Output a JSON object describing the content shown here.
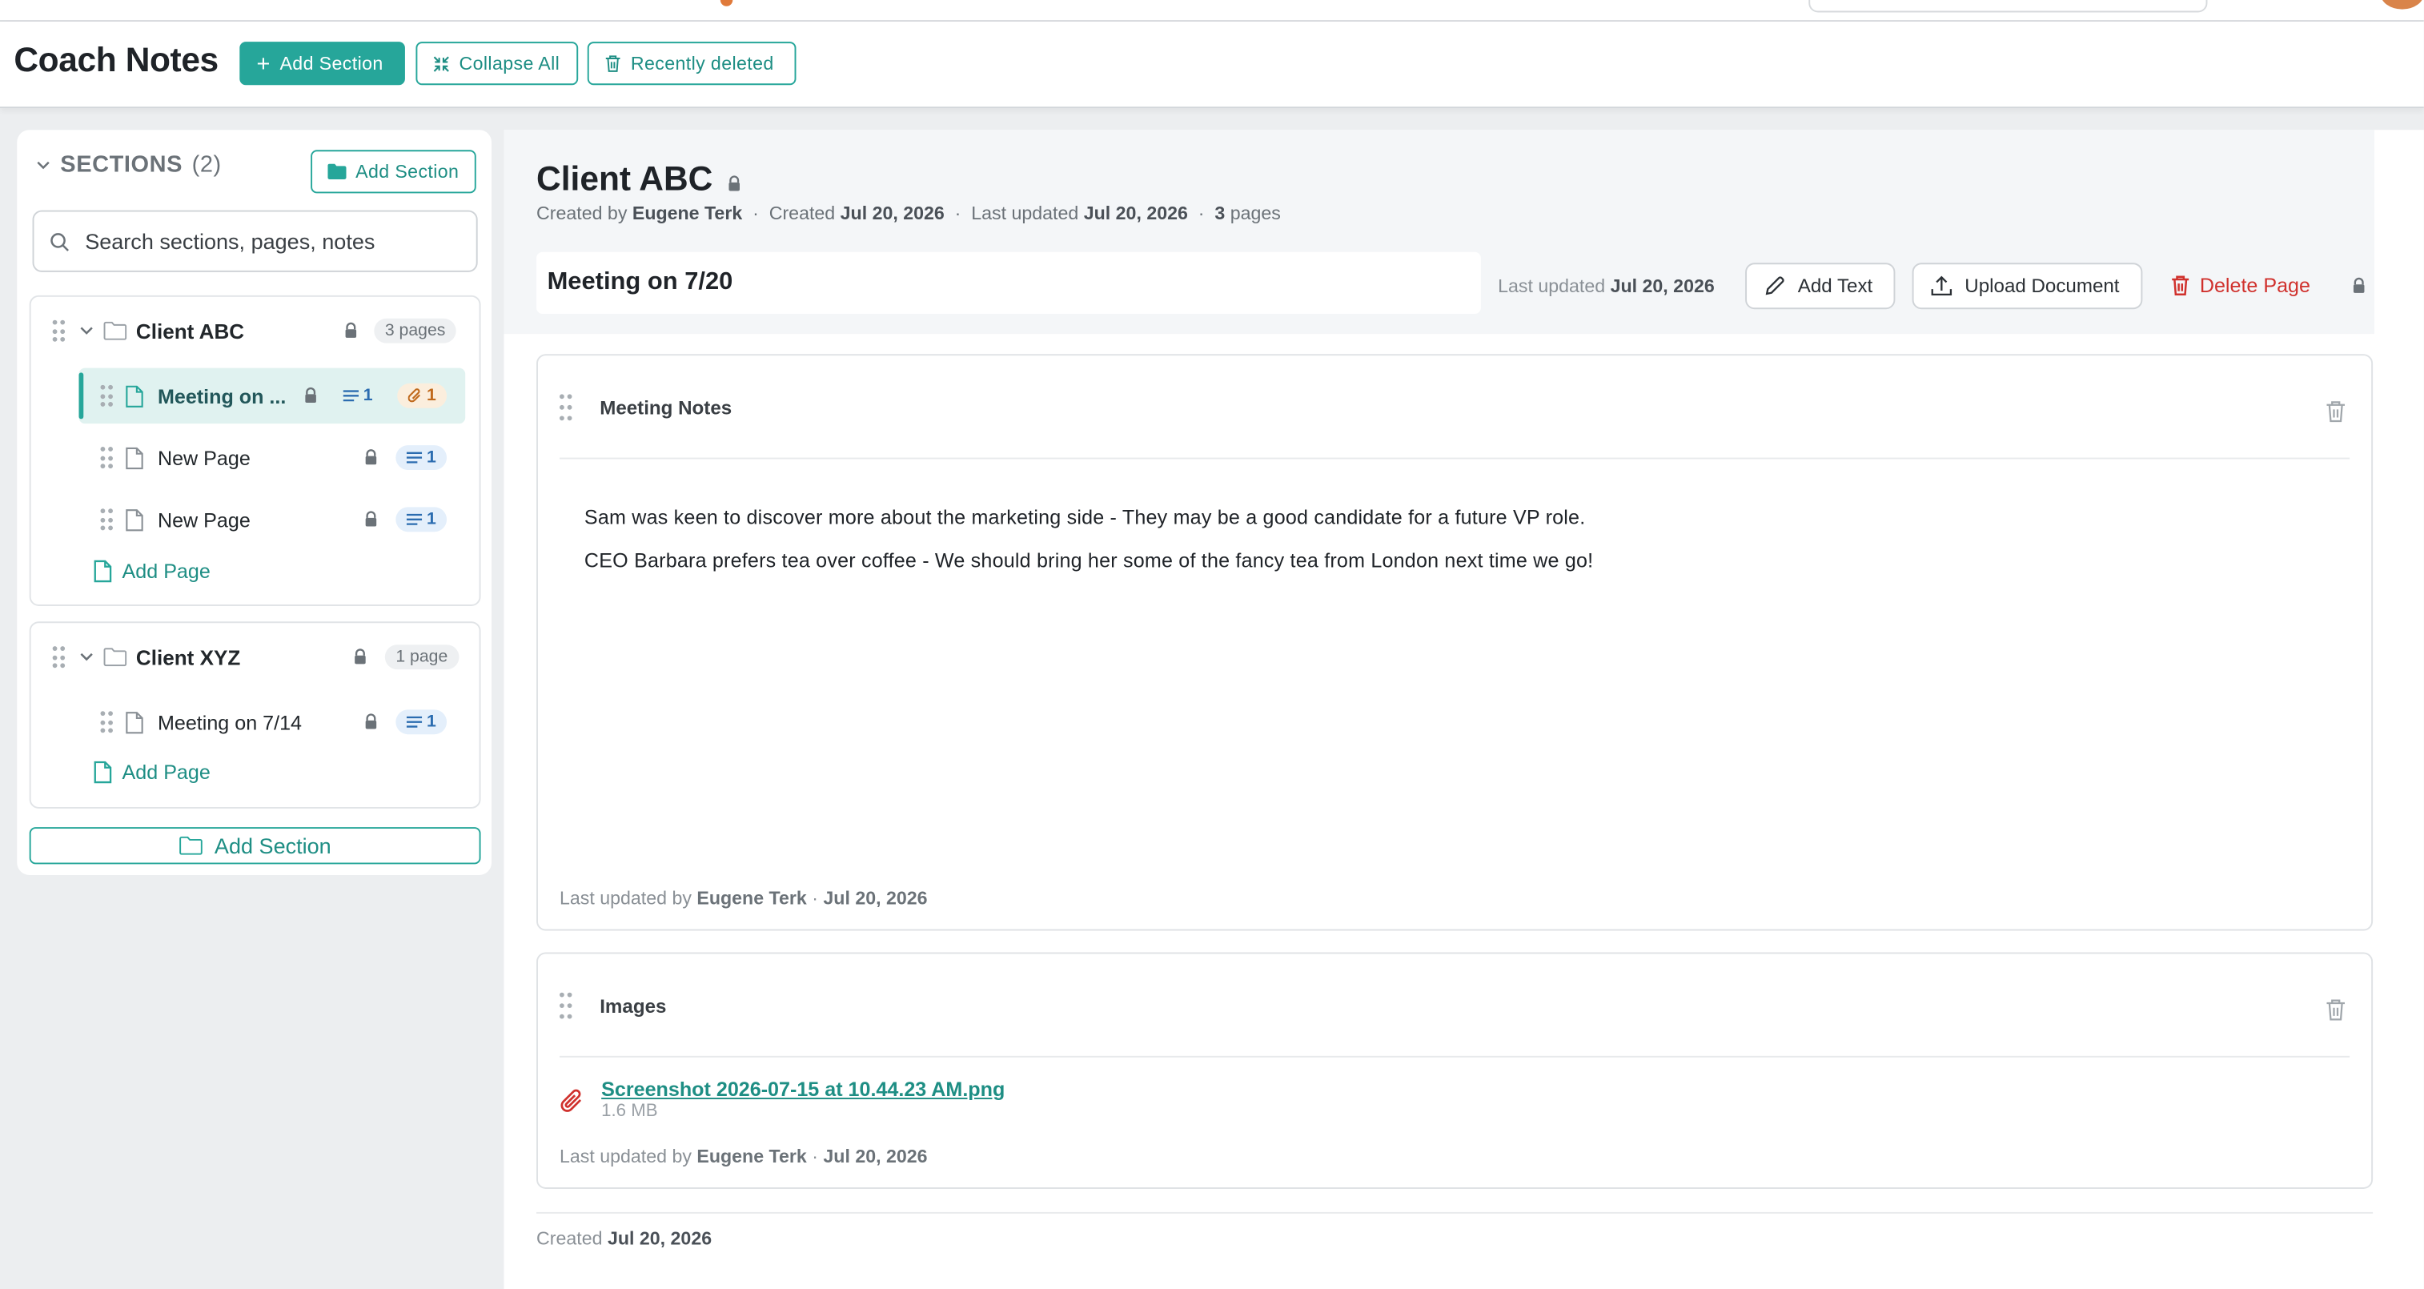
{
  "app": {
    "title": "Coach Notes",
    "add_section_label": "Add Section",
    "collapse_all_label": "Collapse All",
    "recently_deleted_label": "Recently deleted",
    "accent_color": "#26a69a"
  },
  "sidebar": {
    "heading": "SECTIONS",
    "count": "(2)",
    "add_section_label": "Add Section",
    "search_placeholder": "Search sections, pages, notes",
    "sections": [
      {
        "name": "Client ABC",
        "pages_badge": "3 pages",
        "pages": [
          {
            "name": "Meeting on ...",
            "notes": "1",
            "attachments": "1",
            "active": true
          },
          {
            "name": "New Page",
            "notes": "1"
          },
          {
            "name": "New Page",
            "notes": "1"
          }
        ],
        "add_page_label": "Add Page"
      },
      {
        "name": "Client XYZ",
        "pages_badge": "1 page",
        "pages": [
          {
            "name": "Meeting on 7/14",
            "notes": "1"
          }
        ],
        "add_page_label": "Add Page"
      }
    ],
    "bottom_add_section_label": "Add Section"
  },
  "main": {
    "section_title": "Client ABC",
    "meta": {
      "created_by_label": "Created by",
      "created_by": "Eugene Terk",
      "created_label": "Created",
      "created": "Jul 20, 2026",
      "last_updated_label": "Last updated",
      "last_updated": "Jul 20, 2026",
      "pages_count": "3",
      "pages_label": "pages"
    },
    "page_name": "Meeting on 7/20",
    "page_last_updated_label": "Last updated",
    "page_last_updated": "Jul 20, 2026",
    "add_text_label": "Add Text",
    "upload_document_label": "Upload Document",
    "delete_page_label": "Delete Page",
    "notes_card": {
      "title": "Meeting Notes",
      "lines": [
        "Sam was keen to discover more about the marketing side - They may be a good candidate for a future VP role.",
        "CEO Barbara prefers tea over coffee - We should bring her some of the fancy tea from London next time we go!"
      ],
      "footer_label": "Last updated by",
      "footer_user": "Eugene Terk",
      "footer_sep": "·",
      "footer_date": "Jul 20, 2026"
    },
    "images_card": {
      "title": "Images",
      "file_name": "Screenshot 2026-07-15 at 10.44.23 AM.png",
      "file_size": "1.6 MB",
      "footer_label": "Last updated by",
      "footer_user": "Eugene Terk",
      "footer_sep": "·",
      "footer_date": "Jul 20, 2026"
    },
    "created_footer_label": "Created",
    "created_footer_date": "Jul 20, 2026"
  }
}
